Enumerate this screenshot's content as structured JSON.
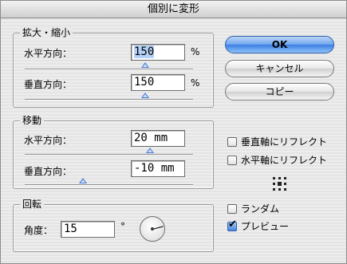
{
  "window": {
    "title": "個別に変形"
  },
  "scale": {
    "legend": "拡大・縮小",
    "horizontal": {
      "label": "水平方向：",
      "value": "150",
      "unit": "%"
    },
    "vertical": {
      "label": "垂直方向：",
      "value": "150",
      "unit": "%"
    }
  },
  "move": {
    "legend": "移動",
    "horizontal": {
      "label": "水平方向：",
      "value": "20 mm"
    },
    "vertical": {
      "label": "垂直方向：",
      "value": "-10 mm"
    }
  },
  "rotate": {
    "legend": "回転",
    "angle_label": "角度：",
    "angle_value": "15",
    "degree_unit": "°"
  },
  "buttons": {
    "ok": "OK",
    "cancel": "キャンセル",
    "copy": "コピー"
  },
  "options": {
    "reflect_vertical": {
      "label": "垂直軸にリフレクト",
      "checked": false
    },
    "reflect_horizontal": {
      "label": "水平軸にリフレクト",
      "checked": false
    },
    "random": {
      "label": "ランダム",
      "checked": false
    },
    "preview": {
      "label": "プレビュー",
      "checked": true
    }
  },
  "icons": {
    "reference_point": "reference-point-grid-icon",
    "angle_dial": "angle-dial-icon"
  },
  "colors": {
    "default_button": "#3a7ee3",
    "selection": "#b5d1f7",
    "slider_thumb": "#4b7fd6"
  }
}
